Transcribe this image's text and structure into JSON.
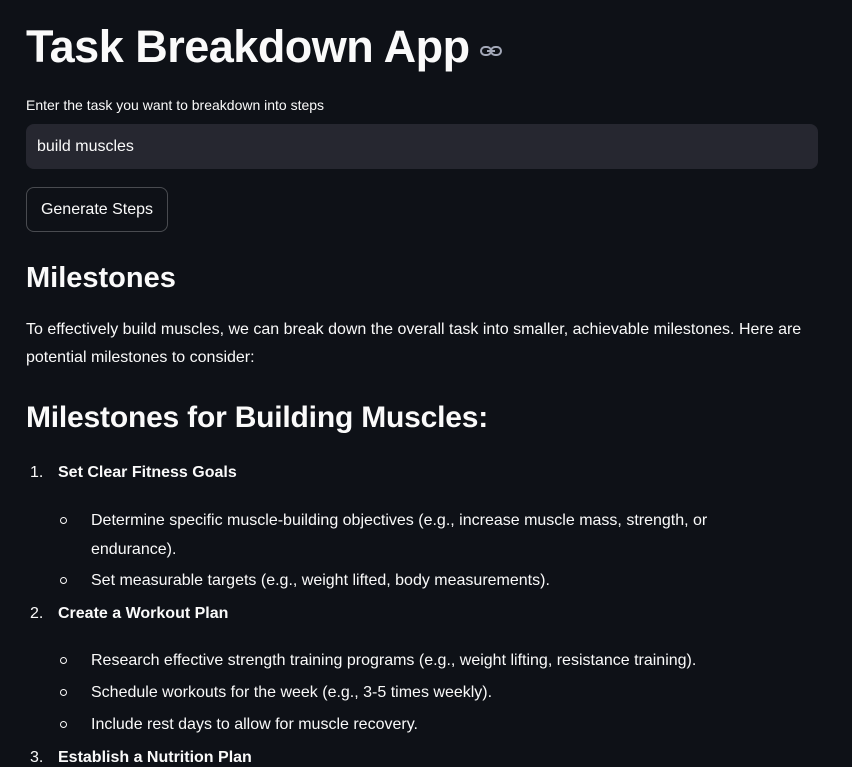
{
  "app": {
    "title": "Task Breakdown App",
    "link_icon": "link-icon"
  },
  "form": {
    "label": "Enter the task you want to breakdown into steps",
    "input_value": "build muscles",
    "button_label": "Generate Steps"
  },
  "content": {
    "heading": "Milestones",
    "intro": "To effectively build muscles, we can break down the overall task into smaller, achievable milestones. Here are potential milestones to consider:",
    "subheading": "Milestones for Building Muscles:",
    "milestones": [
      {
        "number": "1.",
        "title": "Set Clear Fitness Goals",
        "items": [
          "Determine specific muscle-building objectives (e.g., increase muscle mass, strength, or endurance).",
          "Set measurable targets (e.g., weight lifted, body measurements)."
        ]
      },
      {
        "number": "2.",
        "title": "Create a Workout Plan",
        "items": [
          "Research effective strength training programs (e.g., weight lifting, resistance training).",
          "Schedule workouts for the week (e.g., 3-5 times weekly).",
          "Include rest days to allow for muscle recovery."
        ]
      },
      {
        "number": "3.",
        "title": "Establish a Nutrition Plan",
        "items": []
      }
    ]
  },
  "colors": {
    "background": "#0e1117",
    "input_bg": "#262730",
    "text": "#fafafa"
  }
}
